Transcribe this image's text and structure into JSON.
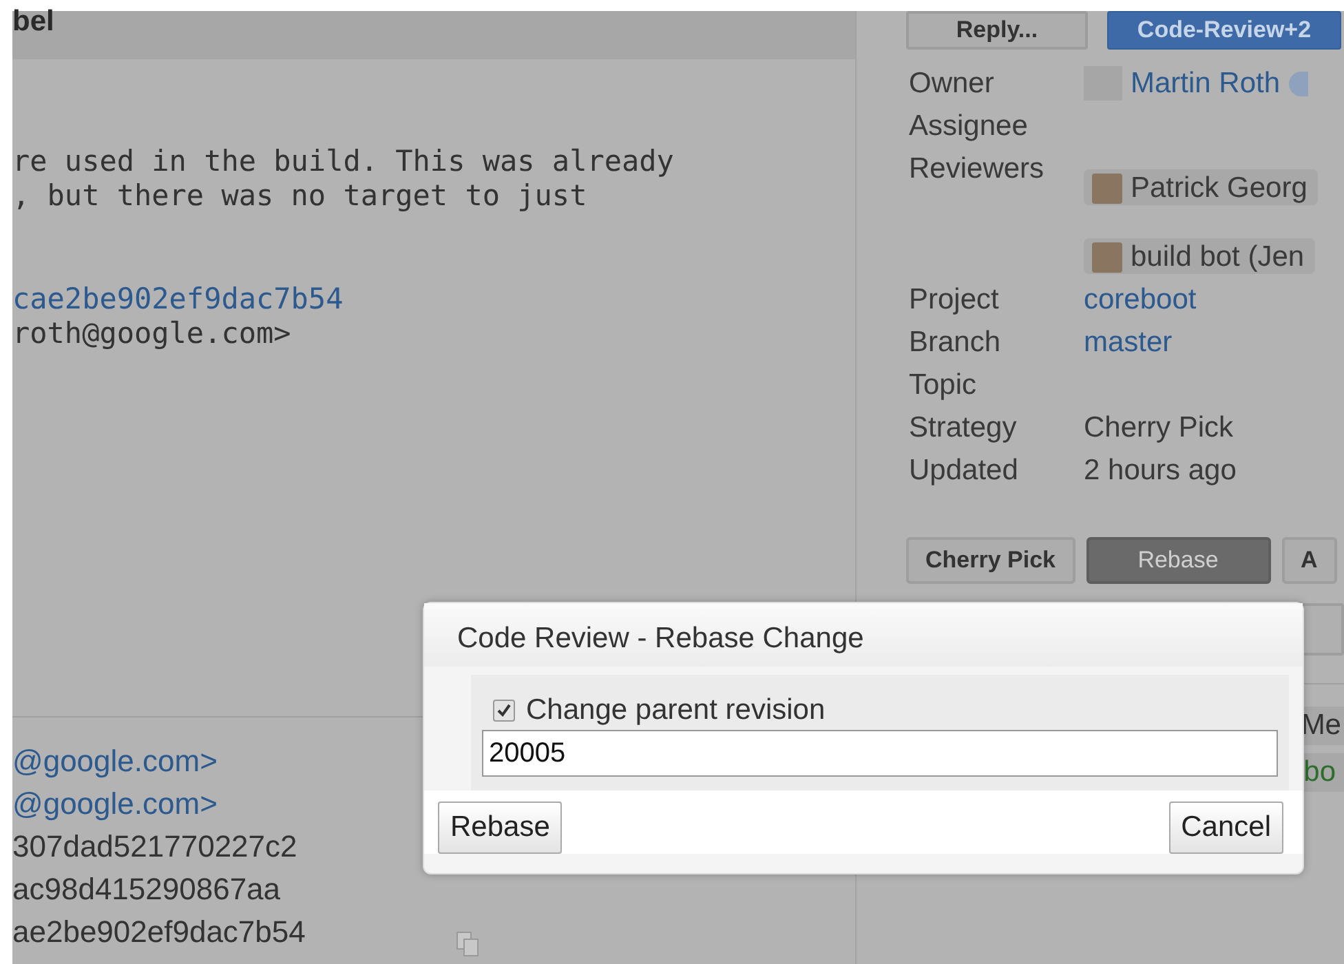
{
  "header": {
    "title": "bel",
    "buttons": [
      {
        "label": "Reply...",
        "kind": "plain"
      },
      {
        "label": "Code-Review+2",
        "kind": "primary"
      }
    ]
  },
  "message": {
    "lines": [
      "re used in the build. This was already",
      ", but there was no target to just"
    ],
    "link": "cae2be902ef9dac7b54",
    "email": "roth@google.com>"
  },
  "commit_info": {
    "emails": [
      "@google.com>",
      "@google.com>"
    ],
    "hashes": [
      "307dad521770227c2",
      "ac98d415290867aa",
      "ae2be902ef9dac7b54"
    ]
  },
  "details": [
    {
      "label": "Owner",
      "kind": "person",
      "value": "Martin Roth"
    },
    {
      "label": "Assignee",
      "kind": "empty"
    },
    {
      "label": "Reviewers",
      "kind": "chips",
      "chips": [
        "Patrick Georg",
        "build bot (Jen"
      ]
    },
    {
      "label": "Project",
      "kind": "link",
      "value": "coreboot"
    },
    {
      "label": "Branch",
      "kind": "link",
      "value": "master"
    },
    {
      "label": "Topic",
      "kind": "empty"
    },
    {
      "label": "Strategy",
      "kind": "text",
      "value": "Cherry Pick"
    },
    {
      "label": "Updated",
      "kind": "text",
      "value": "2 hours ago"
    }
  ],
  "actions": [
    {
      "label": "Cherry Pick",
      "selected": false
    },
    {
      "label": "Rebase",
      "selected": true
    },
    {
      "label": "A",
      "selected": false
    }
  ],
  "related": {
    "tab": "Me",
    "item": "bo"
  },
  "dialog": {
    "title": "Code Review - Rebase Change",
    "checkbox": {
      "label": "Change parent revision",
      "checked": true
    },
    "input": {
      "value": "20005"
    },
    "buttons": [
      "Rebase",
      "Cancel"
    ]
  }
}
